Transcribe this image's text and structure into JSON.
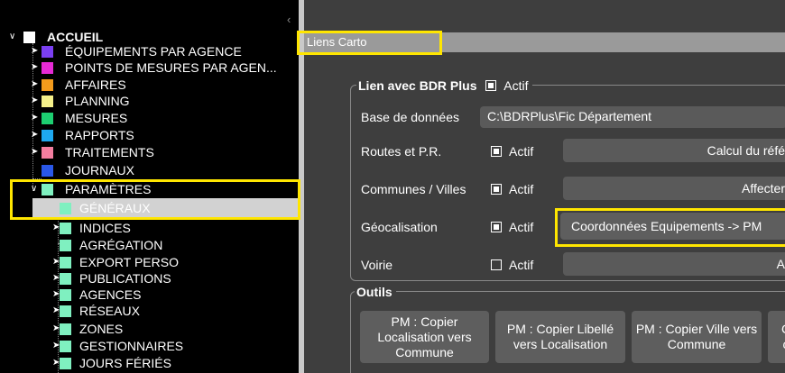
{
  "tree": {
    "collapse_glyph": "‹",
    "root": {
      "label": "ACCUEIL",
      "color": "#ffffff"
    },
    "items": [
      {
        "label": "ÉQUIPEMENTS PAR AGENCE",
        "color": "#7b3ff2"
      },
      {
        "label": "POINTS DE MESURES PAR AGEN...",
        "color": "#e62ad5"
      },
      {
        "label": "AFFAIRES",
        "color": "#f39b1c"
      },
      {
        "label": "PLANNING",
        "color": "#f5f08a"
      },
      {
        "label": "MESURES",
        "color": "#1dcf71"
      },
      {
        "label": "RAPPORTS",
        "color": "#1ea8f0"
      },
      {
        "label": "TRAITEMENTS",
        "color": "#f37ea0"
      },
      {
        "label": "JOURNAUX",
        "color": "#2a58e8"
      },
      {
        "label": "PARAMÈTRES",
        "color": "#7ff0c0"
      }
    ],
    "sub_items": [
      {
        "label": "GÉNÉRAUX",
        "color": "#7ff0c0"
      },
      {
        "label": "INDICES",
        "color": "#7ff0c0"
      },
      {
        "label": "AGRÉGATION",
        "color": "#7ff0c0"
      },
      {
        "label": "EXPORT PERSO",
        "color": "#7ff0c0"
      },
      {
        "label": "PUBLICATIONS",
        "color": "#7ff0c0"
      },
      {
        "label": "AGENCES",
        "color": "#7ff0c0"
      },
      {
        "label": "RÉSEAUX",
        "color": "#7ff0c0"
      },
      {
        "label": "ZONES",
        "color": "#7ff0c0"
      },
      {
        "label": "GESTIONNAIRES",
        "color": "#7ff0c0"
      },
      {
        "label": "JOURS FÉRIÉS",
        "color": "#7ff0c0"
      }
    ]
  },
  "panel": {
    "title": "Liens Carto",
    "bdr": {
      "legend": "Lien avec BDR Plus",
      "active_label": "Actif",
      "db_label": "Base de données",
      "db_value": "C:\\BDRPlus\\Fic Département",
      "rows": [
        {
          "label": "Routes et P.R.",
          "check_label": "Actif",
          "checked": true,
          "button": "Calcul du réfé"
        },
        {
          "label": "Communes / Villes",
          "check_label": "Actif",
          "checked": true,
          "button": "Affecter"
        },
        {
          "label": "Géocalisation",
          "check_label": "Actif",
          "checked": true,
          "button": "Coordonnées Equipements -> PM"
        },
        {
          "label": "Voirie",
          "check_label": "Actif",
          "checked": false,
          "button": "A"
        }
      ]
    },
    "tools": {
      "legend": "Outils",
      "buttons": [
        "PM : Copier Localisation vers Commune",
        "PM : Copier Libellé vers Localisation",
        "PM : Copier Ville vers Commune",
        "C\nc"
      ]
    }
  },
  "colors": {
    "highlight": "#ffe600",
    "selection": "#d2d2d2"
  }
}
